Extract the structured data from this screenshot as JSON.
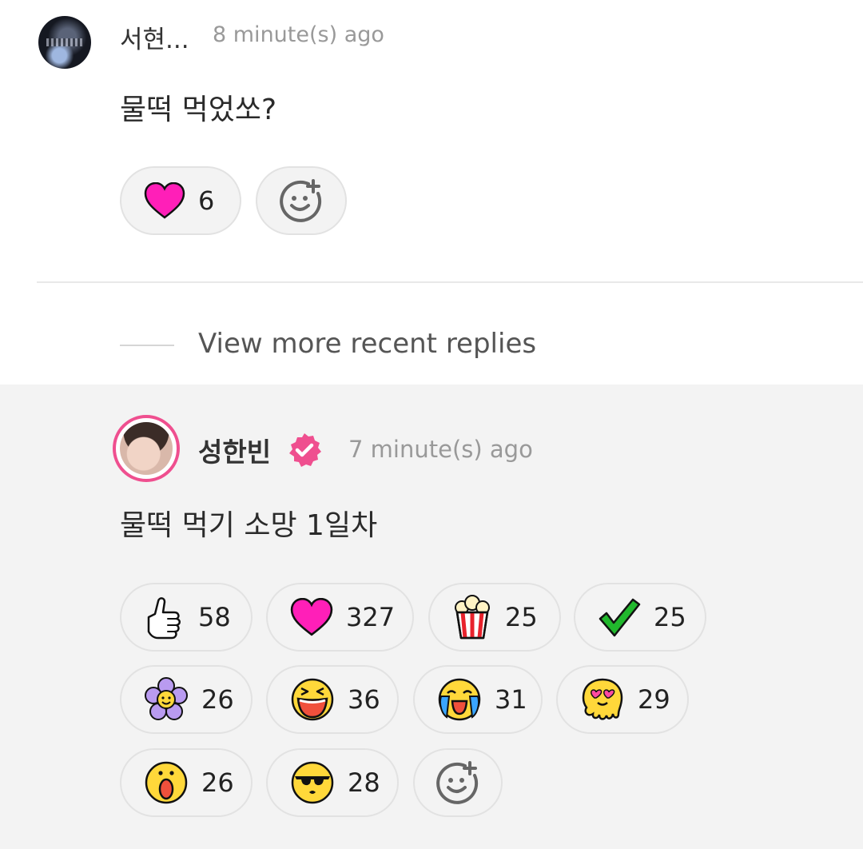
{
  "comment": {
    "author": "서현...",
    "time": "8 minute(s) ago",
    "text": "물떡 먹었쏘?",
    "reactions": [
      {
        "emoji": "heart-emoji",
        "count": "6"
      }
    ]
  },
  "view_more": {
    "label": "View more recent replies"
  },
  "reply": {
    "author": "성한빈",
    "verified": true,
    "time": "7 minute(s) ago",
    "text": "물떡 먹기 소망 1일차",
    "reactions": [
      {
        "emoji": "thumbs-up-emoji",
        "count": "58"
      },
      {
        "emoji": "heart-emoji",
        "count": "327"
      },
      {
        "emoji": "popcorn-emoji",
        "count": "25"
      },
      {
        "emoji": "check-mark-emoji",
        "count": "25"
      },
      {
        "emoji": "flower-emoji",
        "count": "26"
      },
      {
        "emoji": "laughing-emoji",
        "count": "36"
      },
      {
        "emoji": "crying-emoji",
        "count": "31"
      },
      {
        "emoji": "melting-heart-eyes-emoji",
        "count": "29"
      },
      {
        "emoji": "surprised-emoji",
        "count": "26"
      },
      {
        "emoji": "sunglasses-emoji",
        "count": "28"
      }
    ]
  },
  "colors": {
    "heart": "#ff1fb8",
    "verified_badge": "#ef4f8f",
    "avatar_ring": "#ef4f8f",
    "pill_bg": "#f3f3f3",
    "reply_bg": "#f3f3f3"
  }
}
